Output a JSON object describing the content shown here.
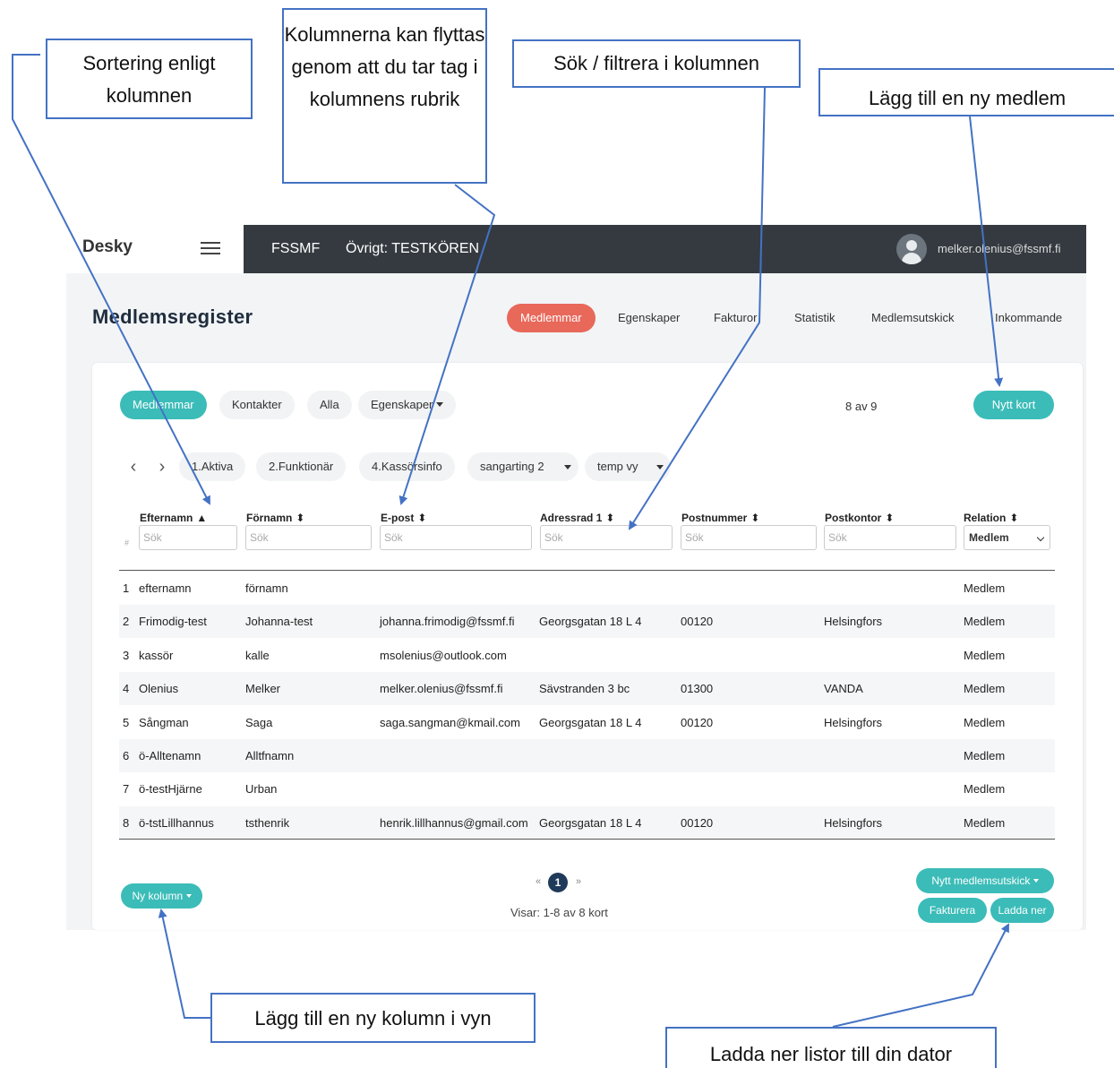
{
  "app": {
    "brand": "Desky",
    "org": "FSSMF",
    "context": "Övrigt: TESTKÖREN",
    "user_email": "melker.olenius@fssmf.fi"
  },
  "page": {
    "title": "Medlemsregister",
    "nav": [
      "Medlemmar",
      "Egenskaper",
      "Fakturor",
      "Statistik",
      "Medlemsutskick",
      "Inkommande"
    ],
    "active_nav": "Medlemmar"
  },
  "filters": {
    "pills": [
      "Medlemmar",
      "Kontakter",
      "Alla",
      "Egenskaper"
    ],
    "count": "8 av 9",
    "new_card": "Nytt kort"
  },
  "views": {
    "items": [
      "1.Aktiva",
      "2.Funktionär",
      "4.Kassörsinfo",
      "sangarting 2",
      "temp vy"
    ]
  },
  "table": {
    "columns": [
      {
        "label": "Efternamn",
        "sort": "▲"
      },
      {
        "label": "Förnamn",
        "sort": "⬍"
      },
      {
        "label": "E-post",
        "sort": "⬍"
      },
      {
        "label": "Adressrad 1",
        "sort": "⬍"
      },
      {
        "label": "Postnummer",
        "sort": "⬍"
      },
      {
        "label": "Postkontor",
        "sort": "⬍"
      },
      {
        "label": "Relation",
        "sort": "⬍"
      }
    ],
    "search_placeholder": "Sök",
    "relation_filter": "Medlem",
    "hash": "#",
    "rows": [
      [
        "1",
        "efternamn",
        "förnamn",
        "",
        "",
        "",
        "",
        "Medlem"
      ],
      [
        "2",
        "Frimodig-test",
        "Johanna-test",
        "johanna.frimodig@fssmf.fi",
        "Georgsgatan 18 L 4",
        "00120",
        "Helsingfors",
        "Medlem"
      ],
      [
        "3",
        "kassör",
        "kalle",
        "msolenius@outlook.com",
        "",
        "",
        "",
        "Medlem"
      ],
      [
        "4",
        "Olenius",
        "Melker",
        "melker.olenius@fssmf.fi",
        "Sävstranden 3 bc",
        "01300",
        "VANDA",
        "Medlem"
      ],
      [
        "5",
        "Sångman",
        "Saga",
        "saga.sangman@kmail.com",
        "Georgsgatan 18 L 4",
        "00120",
        "Helsingfors",
        "Medlem"
      ],
      [
        "6",
        "ö-Alltenamn",
        "Alltfnamn",
        "",
        "",
        "",
        "",
        "Medlem"
      ],
      [
        "7",
        "ö-testHjärne",
        "Urban",
        "",
        "",
        "",
        "",
        "Medlem"
      ],
      [
        "8",
        "ö-tstLillhannus",
        "tsthenrik",
        "henrik.lillhannus@gmail.com",
        "Georgsgatan 18 L 4",
        "00120",
        "Helsingfors",
        "Medlem"
      ]
    ]
  },
  "footer": {
    "new_column": "Ny kolumn",
    "pager_prev": "«",
    "pager_current": "1",
    "pager_next": "»",
    "showing": "Visar: 1-8 av 8 kort",
    "new_mailing": "Nytt medlemsutskick",
    "invoice": "Fakturera",
    "download": "Ladda ner"
  },
  "annotations": {
    "sorting": "Sortering enligt kolumnen",
    "move_columns": "Kolumnerna kan flyttas genom att du tar tag i kolumnens rubrik",
    "search_filter": "Sök / filtrera i kolumnen",
    "add_member": "Lägg till en ny medlem",
    "add_column": "Lägg till en ny kolumn i vyn",
    "download_lists": "Ladda ner listor till din dator"
  },
  "colors": {
    "accent_teal": "#3bbcb8",
    "active_nav": "#e8685a",
    "topbar": "#343a40",
    "callout_border": "#4472c4"
  }
}
